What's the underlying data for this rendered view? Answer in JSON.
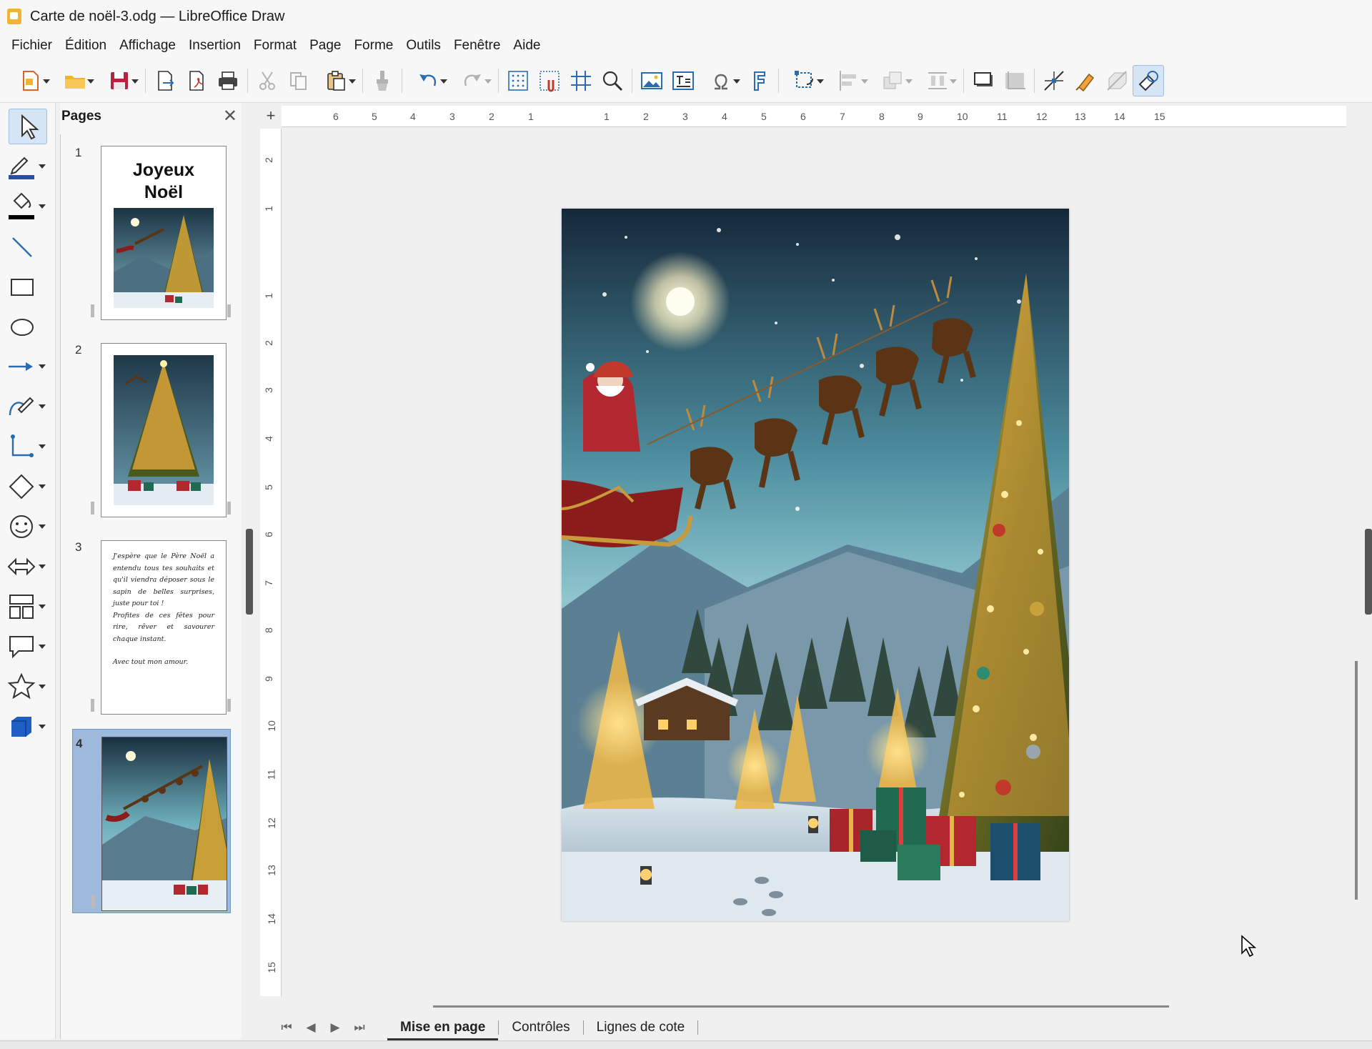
{
  "window": {
    "title": "Carte de noël-3.odg — LibreOffice Draw"
  },
  "menu": [
    "Fichier",
    "Édition",
    "Affichage",
    "Insertion",
    "Format",
    "Page",
    "Forme",
    "Outils",
    "Fenêtre",
    "Aide"
  ],
  "pages_panel": {
    "title": "Pages",
    "close": "✕",
    "pages": [
      {
        "number": "1",
        "title": "Joyeux\nNoël"
      },
      {
        "number": "2"
      },
      {
        "number": "3",
        "paragraphs": [
          "J'espère que le Père Noël a entendu tous tes souhaits et qu'il viendra déposer sous le sapin de belles surprises, juste pour toi !",
          "Profites de ces fêtes pour rire, rêver et savourer chaque instant.",
          "Avec tout mon amour."
        ]
      },
      {
        "number": "4"
      }
    ]
  },
  "ruler": {
    "corner": "+",
    "h_labels": [
      "6",
      "5",
      "4",
      "3",
      "2",
      "1",
      "1",
      "2",
      "3",
      "4",
      "5",
      "6",
      "7",
      "8",
      "9",
      "10",
      "11",
      "12",
      "13",
      "14",
      "15"
    ],
    "v_labels": [
      "2",
      "1",
      "1",
      "2",
      "3",
      "4",
      "5",
      "6",
      "7",
      "8",
      "9",
      "10",
      "11",
      "12",
      "13",
      "14",
      "15"
    ]
  },
  "tabs": {
    "nav": [
      "⏮",
      "◀",
      "▶",
      "⏭"
    ],
    "items": [
      "Mise en page",
      "Contrôles",
      "Lignes de cote"
    ],
    "active": "Mise en page"
  },
  "colors": {
    "accent": "#9dbadd",
    "selected_border": "#6e98c9",
    "night_sky": "#6fb0bd",
    "snow": "#e9eff4"
  }
}
